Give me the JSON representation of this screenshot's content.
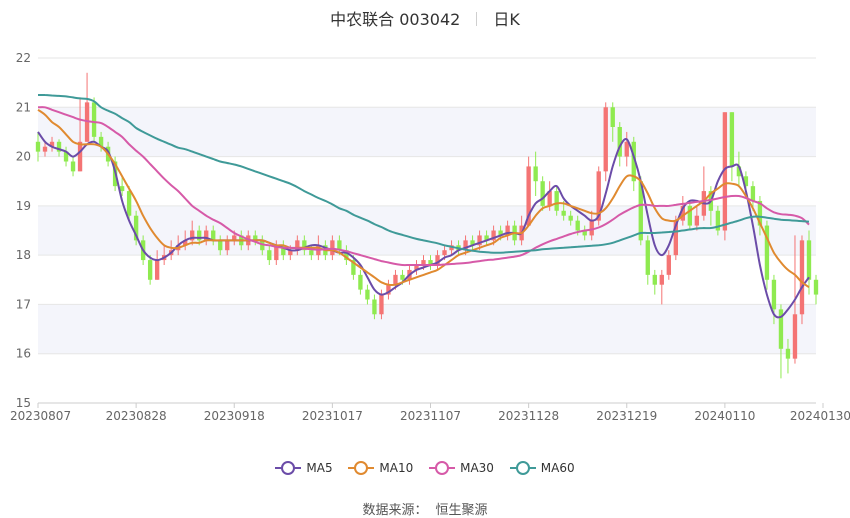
{
  "title": {
    "name": "中农联合 003042",
    "period": "日K"
  },
  "source": {
    "label": "数据来源：",
    "provider": "恒生聚源"
  },
  "colors": {
    "up": "#f47474",
    "down": "#8fea50",
    "ma5": "#6b4ca8",
    "ma10": "#e08a30",
    "ma30": "#d65aa8",
    "ma60": "#3f9a98",
    "grid": "#e6e6e6",
    "band": "#f4f5fb"
  },
  "chart_data": {
    "type": "candlestick",
    "y_ticks": [
      "15",
      "16",
      "17",
      "18",
      "19",
      "20",
      "21",
      "22"
    ],
    "ylim": [
      15,
      22
    ],
    "x_tick_labels": [
      "20230807",
      "20230828",
      "20230918",
      "20231017",
      "20231107",
      "20231128",
      "20231219",
      "20240110",
      "20240130"
    ],
    "x_tick_index": [
      0,
      14,
      28,
      42,
      56,
      70,
      84,
      98,
      112
    ],
    "candles": [
      [
        20.3,
        20.1,
        20.5,
        19.9
      ],
      [
        20.1,
        20.2,
        20.3,
        20.0
      ],
      [
        20.2,
        20.3,
        20.4,
        20.1
      ],
      [
        20.3,
        20.1,
        20.35,
        20.0
      ],
      [
        20.1,
        19.9,
        20.2,
        19.8
      ],
      [
        19.9,
        19.7,
        20.0,
        19.6
      ],
      [
        19.7,
        20.3,
        21.2,
        19.7
      ],
      [
        20.3,
        21.1,
        21.7,
        20.3
      ],
      [
        21.1,
        20.4,
        21.2,
        20.3
      ],
      [
        20.4,
        20.2,
        20.5,
        20.1
      ],
      [
        20.2,
        19.9,
        20.3,
        19.8
      ],
      [
        19.9,
        19.4,
        20.0,
        19.3
      ],
      [
        19.4,
        19.3,
        19.6,
        19.2
      ],
      [
        19.3,
        18.8,
        19.4,
        18.7
      ],
      [
        18.8,
        18.3,
        18.9,
        18.2
      ],
      [
        18.3,
        17.9,
        18.4,
        17.8
      ],
      [
        17.9,
        17.5,
        18.0,
        17.4
      ],
      [
        17.5,
        17.9,
        18.1,
        17.5
      ],
      [
        17.9,
        18.0,
        18.2,
        17.8
      ],
      [
        18.0,
        18.1,
        18.3,
        17.9
      ],
      [
        18.1,
        18.2,
        18.4,
        18.0
      ],
      [
        18.2,
        18.3,
        18.5,
        18.1
      ],
      [
        18.3,
        18.5,
        18.7,
        18.2
      ],
      [
        18.5,
        18.3,
        18.6,
        18.2
      ],
      [
        18.3,
        18.5,
        18.6,
        18.2
      ],
      [
        18.5,
        18.3,
        18.6,
        18.2
      ],
      [
        18.3,
        18.1,
        18.4,
        18.0
      ],
      [
        18.1,
        18.3,
        18.4,
        18.0
      ],
      [
        18.3,
        18.4,
        18.5,
        18.2
      ],
      [
        18.4,
        18.2,
        18.5,
        18.1
      ],
      [
        18.2,
        18.4,
        18.5,
        18.1
      ],
      [
        18.4,
        18.3,
        18.5,
        18.2
      ],
      [
        18.3,
        18.1,
        18.4,
        18.0
      ],
      [
        18.1,
        17.9,
        18.2,
        17.8
      ],
      [
        17.9,
        18.2,
        18.3,
        17.8
      ],
      [
        18.2,
        18.0,
        18.3,
        17.9
      ],
      [
        18.0,
        18.1,
        18.2,
        17.9
      ],
      [
        18.1,
        18.3,
        18.4,
        18.0
      ],
      [
        18.3,
        18.1,
        18.4,
        18.0
      ],
      [
        18.1,
        18.0,
        18.2,
        17.9
      ],
      [
        18.0,
        18.2,
        18.4,
        17.9
      ],
      [
        18.2,
        18.0,
        18.3,
        17.9
      ],
      [
        18.0,
        18.3,
        18.4,
        17.9
      ],
      [
        18.3,
        18.1,
        18.4,
        18.0
      ],
      [
        18.1,
        17.9,
        18.2,
        17.8
      ],
      [
        17.9,
        17.6,
        18.0,
        17.5
      ],
      [
        17.6,
        17.3,
        17.7,
        17.2
      ],
      [
        17.3,
        17.1,
        17.4,
        17.0
      ],
      [
        17.1,
        16.8,
        17.2,
        16.7
      ],
      [
        16.8,
        17.2,
        17.3,
        16.7
      ],
      [
        17.2,
        17.4,
        17.5,
        17.1
      ],
      [
        17.4,
        17.6,
        17.7,
        17.3
      ],
      [
        17.6,
        17.5,
        17.7,
        17.4
      ],
      [
        17.5,
        17.7,
        17.8,
        17.4
      ],
      [
        17.7,
        17.8,
        17.9,
        17.6
      ],
      [
        17.8,
        17.9,
        18.0,
        17.7
      ],
      [
        17.9,
        17.8,
        18.0,
        17.7
      ],
      [
        17.8,
        18.0,
        18.1,
        17.7
      ],
      [
        18.0,
        18.1,
        18.2,
        17.9
      ],
      [
        18.1,
        18.2,
        18.3,
        18.0
      ],
      [
        18.2,
        18.1,
        18.3,
        18.0
      ],
      [
        18.1,
        18.3,
        18.4,
        18.0
      ],
      [
        18.3,
        18.2,
        18.4,
        18.1
      ],
      [
        18.2,
        18.4,
        18.5,
        18.1
      ],
      [
        18.4,
        18.3,
        18.5,
        18.2
      ],
      [
        18.3,
        18.5,
        18.6,
        18.2
      ],
      [
        18.5,
        18.4,
        18.6,
        18.3
      ],
      [
        18.4,
        18.6,
        18.7,
        18.3
      ],
      [
        18.6,
        18.3,
        18.7,
        18.2
      ],
      [
        18.3,
        18.6,
        18.8,
        18.2
      ],
      [
        18.6,
        19.8,
        20.0,
        18.6
      ],
      [
        19.8,
        19.5,
        20.1,
        19.2
      ],
      [
        19.5,
        19.0,
        19.6,
        18.9
      ],
      [
        19.0,
        19.3,
        19.5,
        18.9
      ],
      [
        19.3,
        18.9,
        19.4,
        18.8
      ],
      [
        18.9,
        18.8,
        19.1,
        18.7
      ],
      [
        18.8,
        18.7,
        18.9,
        18.6
      ],
      [
        18.7,
        18.5,
        18.8,
        18.4
      ],
      [
        18.5,
        18.4,
        18.6,
        18.3
      ],
      [
        18.4,
        18.7,
        18.9,
        18.3
      ],
      [
        18.7,
        19.7,
        19.8,
        18.6
      ],
      [
        19.7,
        21.0,
        21.1,
        19.5
      ],
      [
        21.0,
        20.6,
        21.1,
        20.3
      ],
      [
        20.6,
        20.0,
        20.7,
        19.8
      ],
      [
        20.0,
        20.3,
        20.5,
        19.8
      ],
      [
        20.3,
        19.5,
        20.4,
        19.3
      ],
      [
        19.5,
        18.3,
        19.6,
        18.2
      ],
      [
        18.3,
        17.6,
        18.4,
        17.4
      ],
      [
        17.6,
        17.4,
        17.7,
        17.2
      ],
      [
        17.4,
        17.6,
        17.7,
        17.0
      ],
      [
        17.6,
        18.0,
        18.1,
        17.5
      ],
      [
        18.0,
        18.7,
        18.8,
        17.9
      ],
      [
        18.7,
        19.0,
        19.2,
        18.6
      ],
      [
        19.0,
        18.6,
        19.1,
        18.5
      ],
      [
        18.6,
        18.8,
        19.0,
        18.5
      ],
      [
        18.8,
        19.3,
        19.8,
        18.7
      ],
      [
        19.3,
        18.9,
        19.4,
        18.6
      ],
      [
        18.9,
        18.5,
        19.0,
        18.4
      ],
      [
        18.5,
        20.9,
        20.9,
        18.3
      ],
      [
        20.9,
        19.8,
        20.9,
        19.5
      ],
      [
        19.8,
        19.6,
        20.1,
        19.4
      ],
      [
        19.6,
        19.4,
        19.7,
        19.2
      ],
      [
        19.4,
        19.1,
        19.5,
        18.9
      ],
      [
        19.1,
        18.6,
        19.2,
        18.4
      ],
      [
        18.6,
        17.5,
        18.7,
        17.3
      ],
      [
        17.5,
        16.9,
        17.6,
        16.6
      ],
      [
        16.9,
        16.1,
        17.0,
        15.5
      ],
      [
        16.1,
        15.9,
        16.3,
        15.6
      ],
      [
        15.9,
        16.8,
        18.4,
        15.8
      ],
      [
        16.8,
        18.3,
        18.4,
        16.6
      ],
      [
        18.3,
        17.5,
        18.5,
        17.2
      ],
      [
        17.5,
        17.2,
        17.6,
        17.0
      ]
    ],
    "series": [
      {
        "name": "MA5",
        "values": [
          20.5,
          20.3,
          20.2,
          20.15,
          20.1,
          20.0,
          20.1,
          20.25,
          20.3,
          20.2,
          20.1,
          19.7,
          19.1,
          18.7,
          18.4,
          18.1,
          17.95,
          17.9,
          17.95,
          18.05,
          18.2,
          18.3,
          18.35,
          18.35,
          18.35,
          18.3,
          18.3,
          18.3,
          18.3,
          18.3,
          18.3,
          18.3,
          18.3,
          18.25,
          18.2,
          18.15,
          18.1,
          18.1,
          18.15,
          18.2,
          18.2,
          18.15,
          18.1,
          18.05,
          18.05,
          17.95,
          17.8,
          17.55,
          17.3,
          17.2,
          17.25,
          17.35,
          17.45,
          17.6,
          17.7,
          17.75,
          17.8,
          17.85,
          17.95,
          18.0,
          18.1,
          18.15,
          18.2,
          18.25,
          18.3,
          18.35,
          18.4,
          18.45,
          18.45,
          18.45,
          18.8,
          19.05,
          19.15,
          19.3,
          19.4,
          19.15,
          19.0,
          18.9,
          18.8,
          18.7,
          18.8,
          19.25,
          19.8,
          20.2,
          20.35,
          20.0,
          19.5,
          18.8,
          18.2,
          18.0,
          18.2,
          18.6,
          18.95,
          19.1,
          19.1,
          19.05,
          19.1,
          19.5,
          19.75,
          19.8,
          19.8,
          19.3,
          18.6,
          17.8,
          17.2,
          16.8,
          16.75,
          16.9,
          17.1,
          17.35,
          17.55
        ]
      },
      {
        "name": "MA10",
        "values": [
          20.95,
          20.85,
          20.7,
          20.6,
          20.45,
          20.3,
          20.25,
          20.25,
          20.25,
          20.2,
          20.05,
          19.85,
          19.6,
          19.35,
          19.1,
          18.8,
          18.55,
          18.35,
          18.2,
          18.15,
          18.15,
          18.2,
          18.25,
          18.25,
          18.3,
          18.3,
          18.3,
          18.3,
          18.3,
          18.3,
          18.3,
          18.3,
          18.3,
          18.25,
          18.2,
          18.2,
          18.15,
          18.15,
          18.15,
          18.15,
          18.15,
          18.1,
          18.1,
          18.05,
          17.95,
          17.85,
          17.75,
          17.65,
          17.55,
          17.45,
          17.4,
          17.4,
          17.45,
          17.5,
          17.55,
          17.6,
          17.65,
          17.7,
          17.8,
          17.9,
          18.0,
          18.05,
          18.1,
          18.15,
          18.2,
          18.25,
          18.35,
          18.4,
          18.45,
          18.45,
          18.6,
          18.8,
          18.95,
          19.0,
          19.05,
          19.05,
          19.0,
          18.95,
          18.9,
          18.85,
          18.85,
          18.95,
          19.15,
          19.4,
          19.6,
          19.6,
          19.5,
          19.25,
          18.95,
          18.75,
          18.7,
          18.7,
          18.8,
          18.9,
          19.0,
          19.1,
          19.25,
          19.35,
          19.45,
          19.45,
          19.4,
          19.2,
          18.95,
          18.65,
          18.35,
          18.05,
          17.85,
          17.7,
          17.6,
          17.45,
          17.35
        ]
      },
      {
        "name": "MA30",
        "values": [
          21.0,
          21.0,
          20.95,
          20.9,
          20.85,
          20.8,
          20.75,
          20.72,
          20.7,
          20.68,
          20.6,
          20.5,
          20.4,
          20.25,
          20.12,
          20.0,
          19.85,
          19.7,
          19.55,
          19.42,
          19.3,
          19.15,
          19.0,
          18.9,
          18.8,
          18.72,
          18.65,
          18.55,
          18.45,
          18.38,
          18.32,
          18.27,
          18.22,
          18.2,
          18.17,
          18.15,
          18.15,
          18.14,
          18.13,
          18.12,
          18.11,
          18.12,
          18.13,
          18.11,
          18.08,
          18.04,
          18.0,
          17.96,
          17.92,
          17.88,
          17.85,
          17.82,
          17.8,
          17.8,
          17.8,
          17.8,
          17.8,
          17.8,
          17.81,
          17.82,
          17.83,
          17.84,
          17.86,
          17.88,
          17.9,
          17.91,
          17.93,
          17.95,
          17.97,
          18.0,
          18.07,
          18.15,
          18.22,
          18.28,
          18.33,
          18.38,
          18.43,
          18.47,
          18.5,
          18.52,
          18.56,
          18.63,
          18.72,
          18.82,
          18.9,
          18.97,
          19.02,
          19.02,
          19.0,
          19.0,
          19.0,
          19.02,
          19.04,
          19.06,
          19.08,
          19.1,
          19.12,
          19.15,
          19.18,
          19.2,
          19.2,
          19.16,
          19.1,
          19.05,
          18.95,
          18.87,
          18.83,
          18.82,
          18.8,
          18.75,
          18.62
        ]
      },
      {
        "name": "MA60",
        "values": [
          21.25,
          21.25,
          21.24,
          21.23,
          21.22,
          21.2,
          21.18,
          21.17,
          21.12,
          21.0,
          20.93,
          20.87,
          20.78,
          20.7,
          20.58,
          20.5,
          20.43,
          20.36,
          20.3,
          20.24,
          20.18,
          20.15,
          20.1,
          20.05,
          20.0,
          19.95,
          19.9,
          19.87,
          19.84,
          19.8,
          19.75,
          19.7,
          19.65,
          19.6,
          19.55,
          19.5,
          19.45,
          19.38,
          19.3,
          19.23,
          19.16,
          19.1,
          19.03,
          18.95,
          18.9,
          18.82,
          18.76,
          18.7,
          18.63,
          18.57,
          18.5,
          18.45,
          18.41,
          18.37,
          18.33,
          18.3,
          18.27,
          18.24,
          18.2,
          18.17,
          18.14,
          18.11,
          18.09,
          18.07,
          18.06,
          18.05,
          18.05,
          18.06,
          18.07,
          18.08,
          18.09,
          18.1,
          18.12,
          18.13,
          18.14,
          18.15,
          18.16,
          18.17,
          18.18,
          18.19,
          18.2,
          18.22,
          18.25,
          18.3,
          18.35,
          18.4,
          18.45,
          18.45,
          18.45,
          18.46,
          18.47,
          18.48,
          18.5,
          18.52,
          18.54,
          18.55,
          18.55,
          18.58,
          18.62,
          18.66,
          18.7,
          18.75,
          18.78,
          18.78,
          18.76,
          18.74,
          18.72,
          18.71,
          18.7,
          18.69,
          18.68
        ]
      }
    ]
  }
}
